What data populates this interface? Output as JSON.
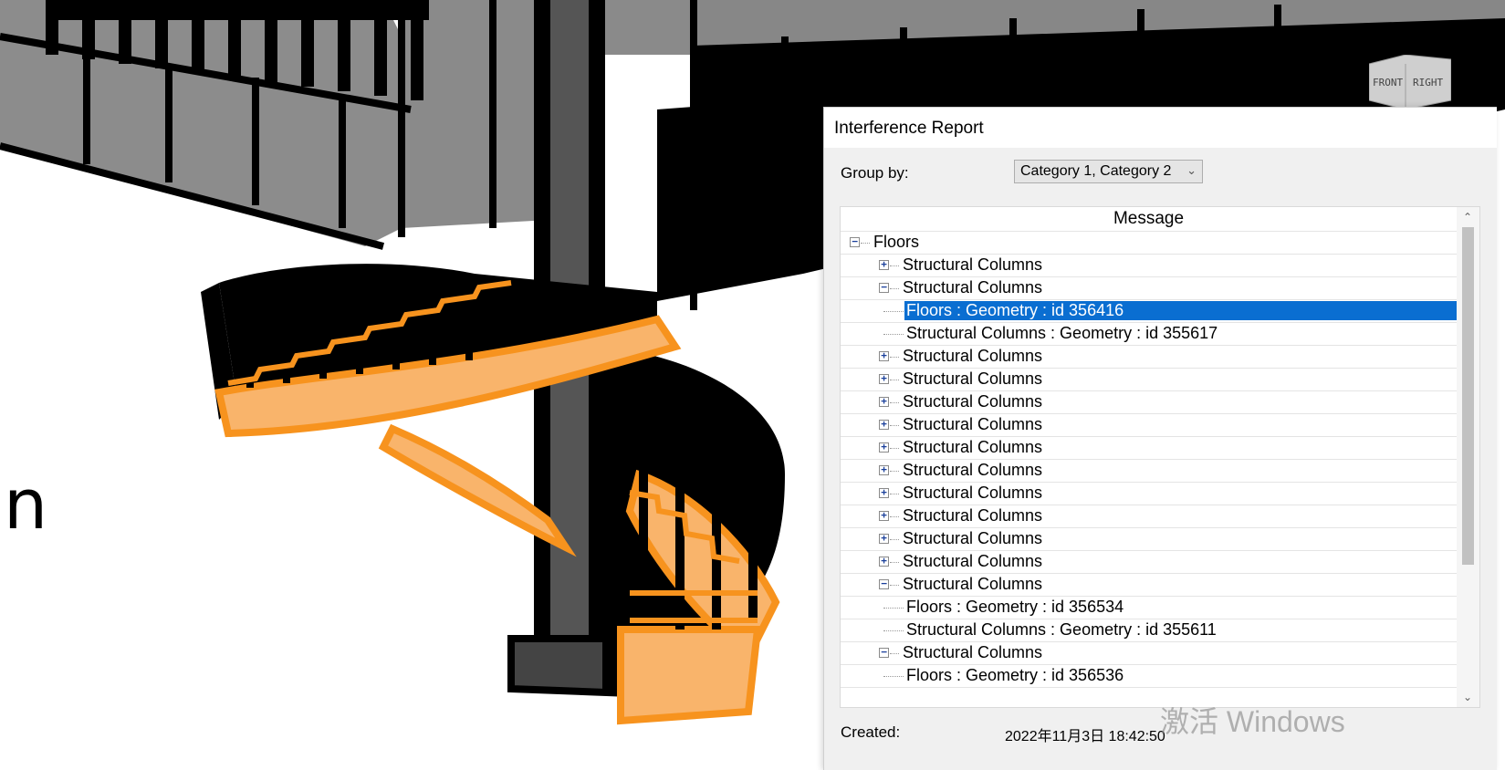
{
  "viewport": {
    "side_text": "n",
    "viewcube_faces": [
      "FRONT",
      "RIGHT"
    ]
  },
  "dialog": {
    "title": "Interference Report",
    "group_by_label": "Group by:",
    "group_by_value": "Category 1, Category 2",
    "list_header": "Message",
    "rows": [
      {
        "level": 0,
        "toggle": "minus",
        "label": "Floors"
      },
      {
        "level": 1,
        "toggle": "plus",
        "label": "Structural Columns"
      },
      {
        "level": 1,
        "toggle": "minus",
        "label": "Structural Columns"
      },
      {
        "level": 2,
        "toggle": "none",
        "label": "Floors : Geometry : id 356416",
        "selected": true
      },
      {
        "level": 2,
        "toggle": "none",
        "label": "Structural Columns : Geometry : id 355617"
      },
      {
        "level": 1,
        "toggle": "plus",
        "label": "Structural Columns"
      },
      {
        "level": 1,
        "toggle": "plus",
        "label": "Structural Columns"
      },
      {
        "level": 1,
        "toggle": "plus",
        "label": "Structural Columns"
      },
      {
        "level": 1,
        "toggle": "plus",
        "label": "Structural Columns"
      },
      {
        "level": 1,
        "toggle": "plus",
        "label": "Structural Columns"
      },
      {
        "level": 1,
        "toggle": "plus",
        "label": "Structural Columns"
      },
      {
        "level": 1,
        "toggle": "plus",
        "label": "Structural Columns"
      },
      {
        "level": 1,
        "toggle": "plus",
        "label": "Structural Columns"
      },
      {
        "level": 1,
        "toggle": "plus",
        "label": "Structural Columns"
      },
      {
        "level": 1,
        "toggle": "plus",
        "label": "Structural Columns"
      },
      {
        "level": 1,
        "toggle": "minus",
        "label": "Structural Columns"
      },
      {
        "level": 2,
        "toggle": "none",
        "label": "Floors : Geometry : id 356534"
      },
      {
        "level": 2,
        "toggle": "none",
        "label": "Structural Columns : Geometry : id 355611"
      },
      {
        "level": 1,
        "toggle": "minus",
        "label": "Structural Columns"
      },
      {
        "level": 2,
        "toggle": "none",
        "label": "Floors : Geometry : id 356536"
      }
    ],
    "created_label": "Created:",
    "created_value": "2022年11月3日 18:42:50",
    "watermark": "激活 Windows"
  },
  "colors": {
    "selection": "#0a6ed1",
    "stair_orange": "#f7931e",
    "stair_light": "#f9b46b",
    "wall_gray": "#8c8c8c"
  }
}
